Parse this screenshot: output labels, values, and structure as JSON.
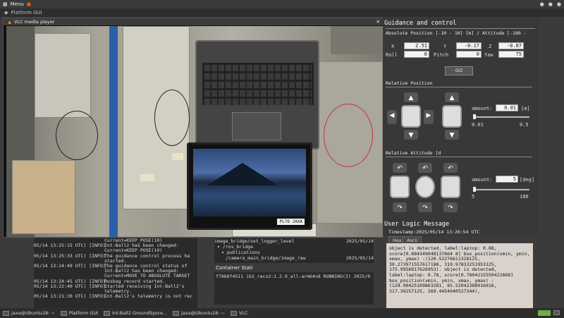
{
  "topbar": {
    "menu_label": "Menu"
  },
  "gui_title": "Platform GUI",
  "vlc": {
    "title": "VLC media player",
    "screen_tag": "PL76 JAXA"
  },
  "guidance": {
    "title": "Guidance and control",
    "abs_label": "Absolute Position [-10 - 10] [m] / Attitude [-180 -",
    "x_label": "X",
    "x_value": "2.51",
    "y_label": "Y",
    "y_value": "-0.17",
    "z_label": "Z",
    "z_value": "-0.87",
    "roll_label": "Roll",
    "roll_value": "0",
    "pitch_label": "Pitch",
    "pitch_value": "0",
    "yaw_label": "Yaw",
    "yaw_value": "75",
    "go_label": "GO",
    "rel_pos_label": "Relative Position",
    "amount_label": "amount:",
    "amount_pos_value": "0.01",
    "amount_pos_unit": "[m]",
    "pos_min": "0.01",
    "pos_max": "0.5",
    "rel_att_label": "Relative Attitude [d",
    "amount_att_value": "5",
    "amount_att_unit": "[deg]",
    "att_min": "5",
    "att_max": "180"
  },
  "ulm": {
    "title": "User Logic Message",
    "timestamp": "Timestamp:2025/05/14 13:26:54 UTC",
    "tab_hex": "Hex",
    "tab_ascii": "Ascii",
    "message": "object is detected, label:laptop: 0.88, score[0.884349048137664 8] box_position(xmin, ymin, xmax, ymax) :(120.52276611328125, 30.273971557617188, 319.97833251953125, 175.9956817626953). object is detected, label:laptop: 0.78, score[0.7804215550422668] box_position(xmin, ymin, xmax, ymax) :(124.90425109863281, 85.52042388916016, 317.39257125, 269.4454040527344),"
  },
  "log": [
    {
      "t": "",
      "m": "Current=KEEP_POSE(10)"
    },
    {
      "t": "05/14 13:25:15 UTC) [INFO]",
      "m": "Int-Ball2 has been changed:"
    },
    {
      "t": "",
      "m": "Current=KEEP POSE(10)"
    },
    {
      "t": "05/14 13:25:33 UTC) [INFO]",
      "m": "The guidance control process ha"
    },
    {
      "t": "",
      "m": "started."
    },
    {
      "t": "05/14 13:24:49 UTC) [INFO]",
      "m": "The guidance control status of"
    },
    {
      "t": "",
      "m": "Int-Ball2 has been changed:"
    },
    {
      "t": "",
      "m": "Current=MOVE TO ABSOLUTE TARGET"
    },
    {
      "t": "05/14 13:24:45 UTC) [INFO]",
      "m": "Rosbag record started."
    },
    {
      "t": "05/14 13:22:40 UTC) [INFO]",
      "m": "Started receiving Int-Ball2's"
    },
    {
      "t": "",
      "m": "telemetry."
    },
    {
      "t": "05/14 13:21:30 UTC) [INFO]",
      "m": "Int-Ball2's telemetry is not rec"
    }
  ],
  "topics": {
    "line1": "image_bridge/set_logger_level",
    "line1_date": "2025/05/14",
    "line2": "▾ /ros_bridge",
    "line3": "▾ publications",
    "line4": "/camera_main_bridge/image_raw",
    "line4_date": "2025/05/14"
  },
  "container": {
    "header": "Container Stati",
    "row": "f78b8f4511 ib2_racs2:1.2.0_all-arm64v8 RUNNING(3) 2025/0"
  },
  "taskbar": {
    "t1": "jaxa@Ubuntu18: ~",
    "t2": "Platform GUI",
    "t3": "Int-Ball2 GroundSysce...",
    "t4": "jaxa@Ubuntu18: ~",
    "t5": "VLC"
  }
}
